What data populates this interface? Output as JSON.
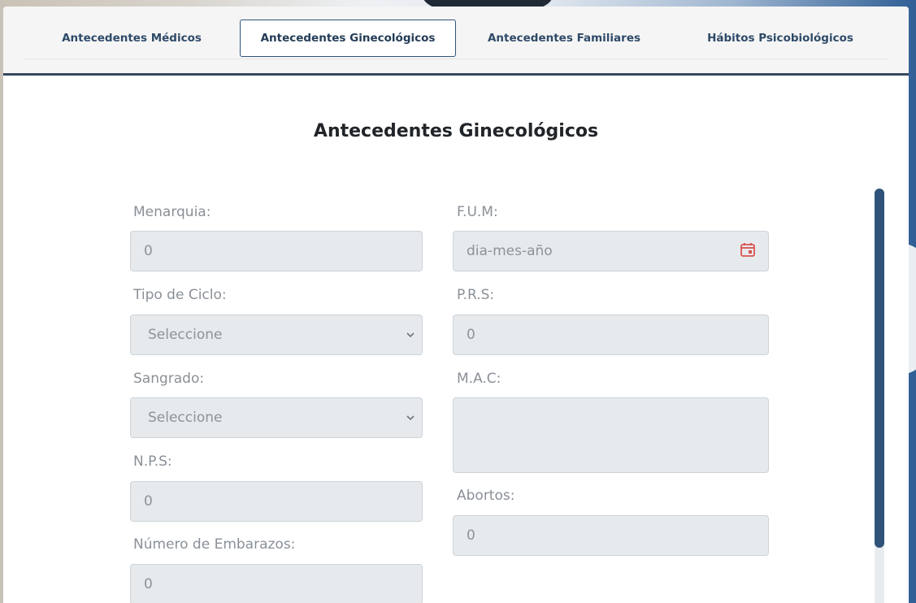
{
  "tabs": [
    {
      "label": "Antecedentes Médicos"
    },
    {
      "label": "Antecedentes Ginecológicos"
    },
    {
      "label": "Antecedentes Familiares"
    },
    {
      "label": "Hábitos Psicobiológicos"
    }
  ],
  "active_tab_index": 1,
  "section_title": "Antecedentes Ginecológicos",
  "fields": {
    "menarquia": {
      "label": "Menarquia:",
      "value": "0"
    },
    "fum": {
      "label": "F.U.M:",
      "placeholder": "dia-mes-año"
    },
    "tipo_ciclo": {
      "label": "Tipo de Ciclo:",
      "selected": "Seleccione"
    },
    "prs": {
      "label": "P.R.S:",
      "value": "0"
    },
    "sangrado": {
      "label": "Sangrado:",
      "selected": "Seleccione"
    },
    "mac": {
      "label": "M.A.C:",
      "value": ""
    },
    "nps": {
      "label": "N.P.S:",
      "value": "0"
    },
    "abortos": {
      "label": "Abortos:",
      "value": "0"
    },
    "numero_embarazos": {
      "label": "Número de Embarazos:",
      "value": "0"
    }
  },
  "icons": {
    "calendar": "calendar-icon",
    "chevron": "chevron-down-icon"
  },
  "colors": {
    "accent": "#2f5378",
    "calendar_icon": "#d9534f",
    "field_bg": "#e7eaed"
  }
}
